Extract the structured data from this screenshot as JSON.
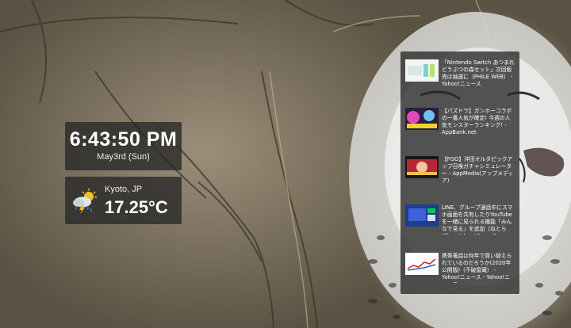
{
  "clock": {
    "time": "6:43:50 PM",
    "date": "May3rd (Sun)"
  },
  "weather": {
    "city": "Kyoto, JP",
    "temperature": "17.25°C",
    "icon": "thunderstorm-sun-icon"
  },
  "news": [
    {
      "headline": "「Nintendo Switch あつまれ どうぶつの森セット」次回販売は抽選に（PHILE WEB） - Yahoo!ニュース",
      "thumb": "switch-thumbnail"
    },
    {
      "headline": "【パズドラ】ガンホーコラボの一番人気が確定! 今週の人気モンスターランキング! - AppBank.net",
      "thumb": "puzzle-dragons-thumbnail"
    },
    {
      "headline": "【FGO】沖田オルタピックアップ召喚ガチャシミュレーター - AppMedia(アップメディア)",
      "thumb": "fgo-thumbnail"
    },
    {
      "headline": "LINE、グループ通話中にスマホ画面を共有したりYouTubeを一緒に見られる機能「みんなで見る」を追加（ねとらぼ） - Yahoo!ニュース",
      "thumb": "line-thumbnail"
    },
    {
      "headline": "携帯電話は何年で買い替えられているのだろうか(2020年公開版)（不破雷蔵） - Yahoo!ニュース - Yahoo!ニュース",
      "thumb": "phone-chart-thumbnail"
    }
  ]
}
